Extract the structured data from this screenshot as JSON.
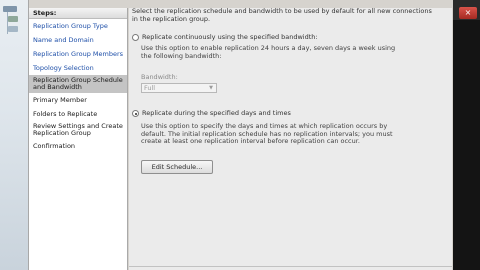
{
  "title_bar": {
    "close_glyph": "×"
  },
  "steps": {
    "header": "Steps:",
    "items": [
      {
        "label": "Replication Group Type",
        "state": "link"
      },
      {
        "label": "Name and Domain",
        "state": "link"
      },
      {
        "label": "Replication Group Members",
        "state": "link"
      },
      {
        "label": "Topology Selection",
        "state": "link"
      },
      {
        "label": "Replication Group Schedule and Bandwidth",
        "state": "active"
      },
      {
        "label": "Primary Member",
        "state": "plain"
      },
      {
        "label": "Folders to Replicate",
        "state": "plain"
      },
      {
        "label": "Review Settings and Create Replication Group",
        "state": "plain"
      },
      {
        "label": "Confirmation",
        "state": "plain"
      }
    ]
  },
  "content": {
    "intro": "Select the replication schedule and bandwidth to be used by default for all new connections in the replication group.",
    "option_continuous": {
      "label": "Replicate continuously using the specified bandwidth:",
      "description": "Use this option to enable replication 24 hours a day, seven days a week using the following bandwidth:",
      "selected": false
    },
    "bandwidth": {
      "label": "Bandwidth:",
      "value": "Full"
    },
    "option_scheduled": {
      "label": "Replicate during the specified days and times",
      "description": "Use this option to specify the days and times at which replication occurs by default. The initial replication schedule has no replication intervals; you must create at least one replication interval before replication can occur.",
      "selected": true
    },
    "edit_schedule_button": "Edit Schedule..."
  },
  "colors": {
    "step_link": "#1e4fa8",
    "active_step_bg": "#c4c4c4",
    "content_bg": "#ebebeb"
  }
}
